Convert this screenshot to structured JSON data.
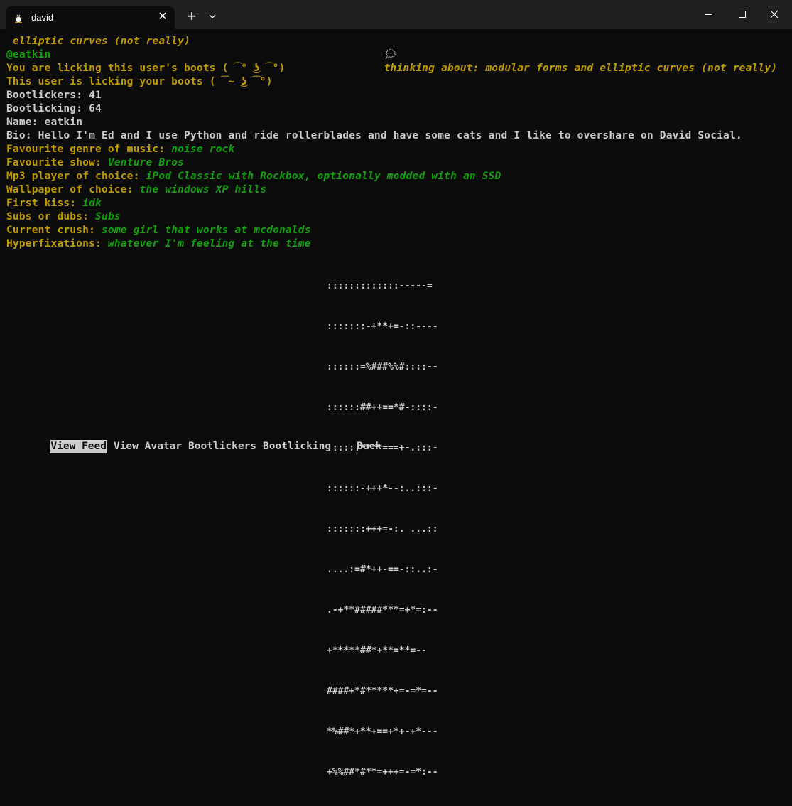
{
  "window": {
    "tab_title": "david",
    "tab_icon": "linux-penguin-icon",
    "tab_close": "✕",
    "new_tab": "+",
    "dropdown_icon": "chevron-down-icon",
    "minimize_icon": "minimize-icon",
    "maximize_icon": "maximize-icon",
    "close_icon": "close-icon"
  },
  "header": {
    "left_status": "elliptic curves (not really)",
    "thinking_icon": "🗯",
    "right_status": "thinking about: modular forms and elliptic curves (not really)"
  },
  "profile": {
    "handle": "@eatkin",
    "licking_their_boots": "You are licking this user's boots ( ͡° ͜ʖ ͡°)",
    "licking_your_boots": "This user is licking your boots ( ͡~ ͜ʖ ͡°)",
    "bootlickers": "Bootlickers: 41",
    "bootlicking": "Bootlicking: 64",
    "name": "Name: eatkin",
    "bio": "Bio: Hello I'm Ed and I use Python and ride rollerblades and have some cats and I like to overshare on David Social.",
    "fields": [
      {
        "label": "Favourite genre of music:",
        "value": "noise rock"
      },
      {
        "label": "Favourite show:",
        "value": "Venture Bros"
      },
      {
        "label": "Mp3 player of choice:",
        "value": "iPod Classic with Rockbox, optionally modded with an SSD"
      },
      {
        "label": "Wallpaper of choice:",
        "value": "the windows XP hills"
      },
      {
        "label": "First kiss:",
        "value": "idk"
      },
      {
        "label": "Subs or dubs:",
        "value": "Subs"
      },
      {
        "label": "Current crush:",
        "value": "some girl that works at mcdonalds"
      },
      {
        "label": "Hyperfixations:",
        "value": "whatever I'm feeling at the time"
      }
    ]
  },
  "avatar_art": [
    ":::::::::::::-----=",
    ":::::::-+**+=-::----",
    "::::::=%###%%#::::--",
    "::::::##++==*#-::::-",
    "::::::****===+-.:::-",
    "::::::-+++*--:..:::-",
    ":::::::+++=-:. ...::",
    "....:=#*++-==-::..:-",
    ".-+**#####***=+*=:--",
    "+*****##*+**=**=--",
    "####+*#*****+=-=*=--",
    "*%##*+**+==+*+-+*---",
    "+%%##*#**=+++=-=*:--"
  ],
  "menu": {
    "items": [
      "View Feed",
      "View Avatar",
      "Bootlickers",
      "Bootlicking",
      "Back"
    ],
    "selected": "View Feed"
  },
  "colors": {
    "background": "#0c0c0c",
    "titlebar": "#202020",
    "yellow": "#c19c00",
    "green": "#13a10e",
    "text": "#cccccc"
  }
}
